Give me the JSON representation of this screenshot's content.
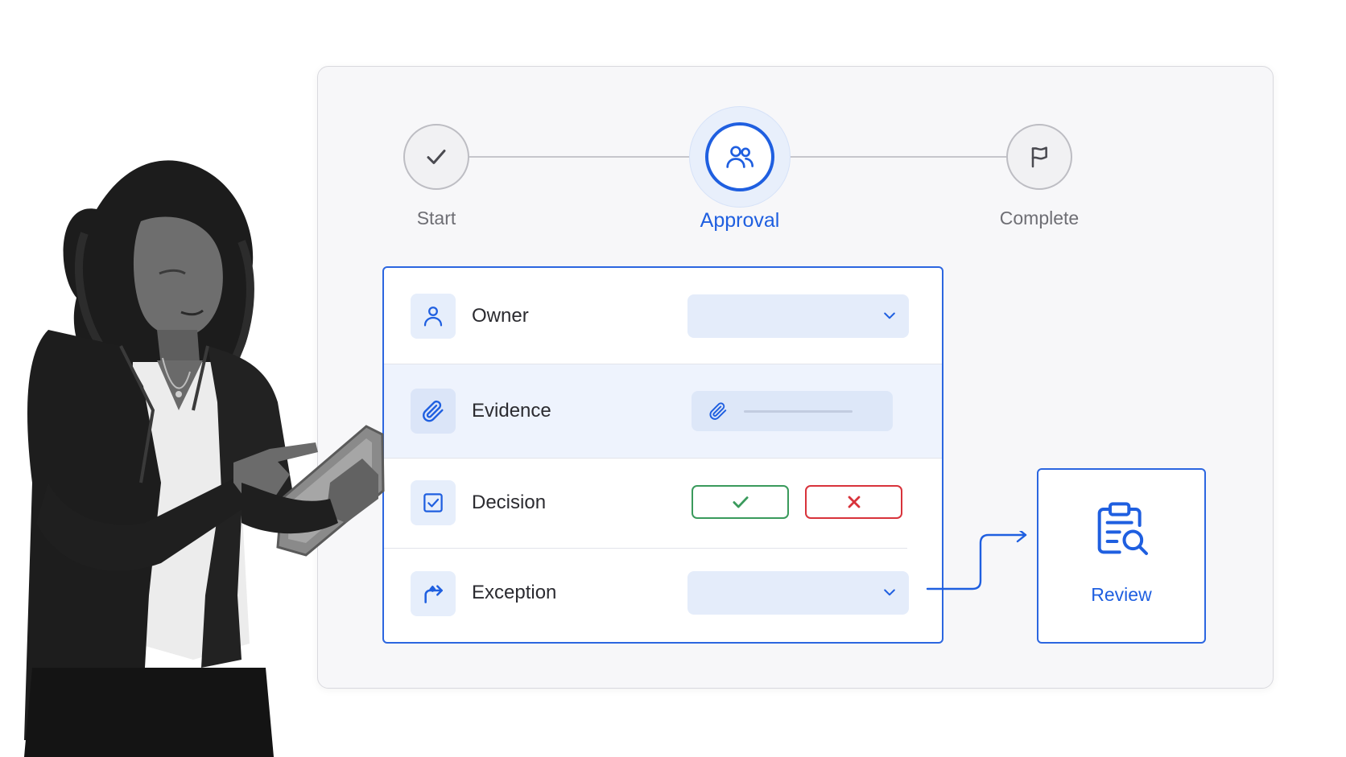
{
  "stepper": {
    "steps": [
      {
        "label": "Start",
        "state": "done",
        "icon": "check-icon"
      },
      {
        "label": "Approval",
        "state": "active",
        "icon": "users-icon"
      },
      {
        "label": "Complete",
        "state": "todo",
        "icon": "flag-icon"
      }
    ]
  },
  "form": {
    "rows": [
      {
        "label": "Owner",
        "icon": "user-icon",
        "control": "select",
        "value": ""
      },
      {
        "label": "Evidence",
        "icon": "paperclip-icon",
        "control": "file",
        "value": ""
      },
      {
        "label": "Decision",
        "icon": "checkbox-icon",
        "control": "approve-reject"
      },
      {
        "label": "Exception",
        "icon": "redirect-arrow-icon",
        "control": "select",
        "value": ""
      }
    ],
    "decision": {
      "approve_icon": "check-icon",
      "reject_icon": "x-icon"
    }
  },
  "review": {
    "label": "Review",
    "icon": "clipboard-search-icon"
  },
  "colors": {
    "accent": "#1f5fe0",
    "approve": "#3a9a5c",
    "reject": "#d8333b",
    "field_fill": "#e4ecfa"
  }
}
